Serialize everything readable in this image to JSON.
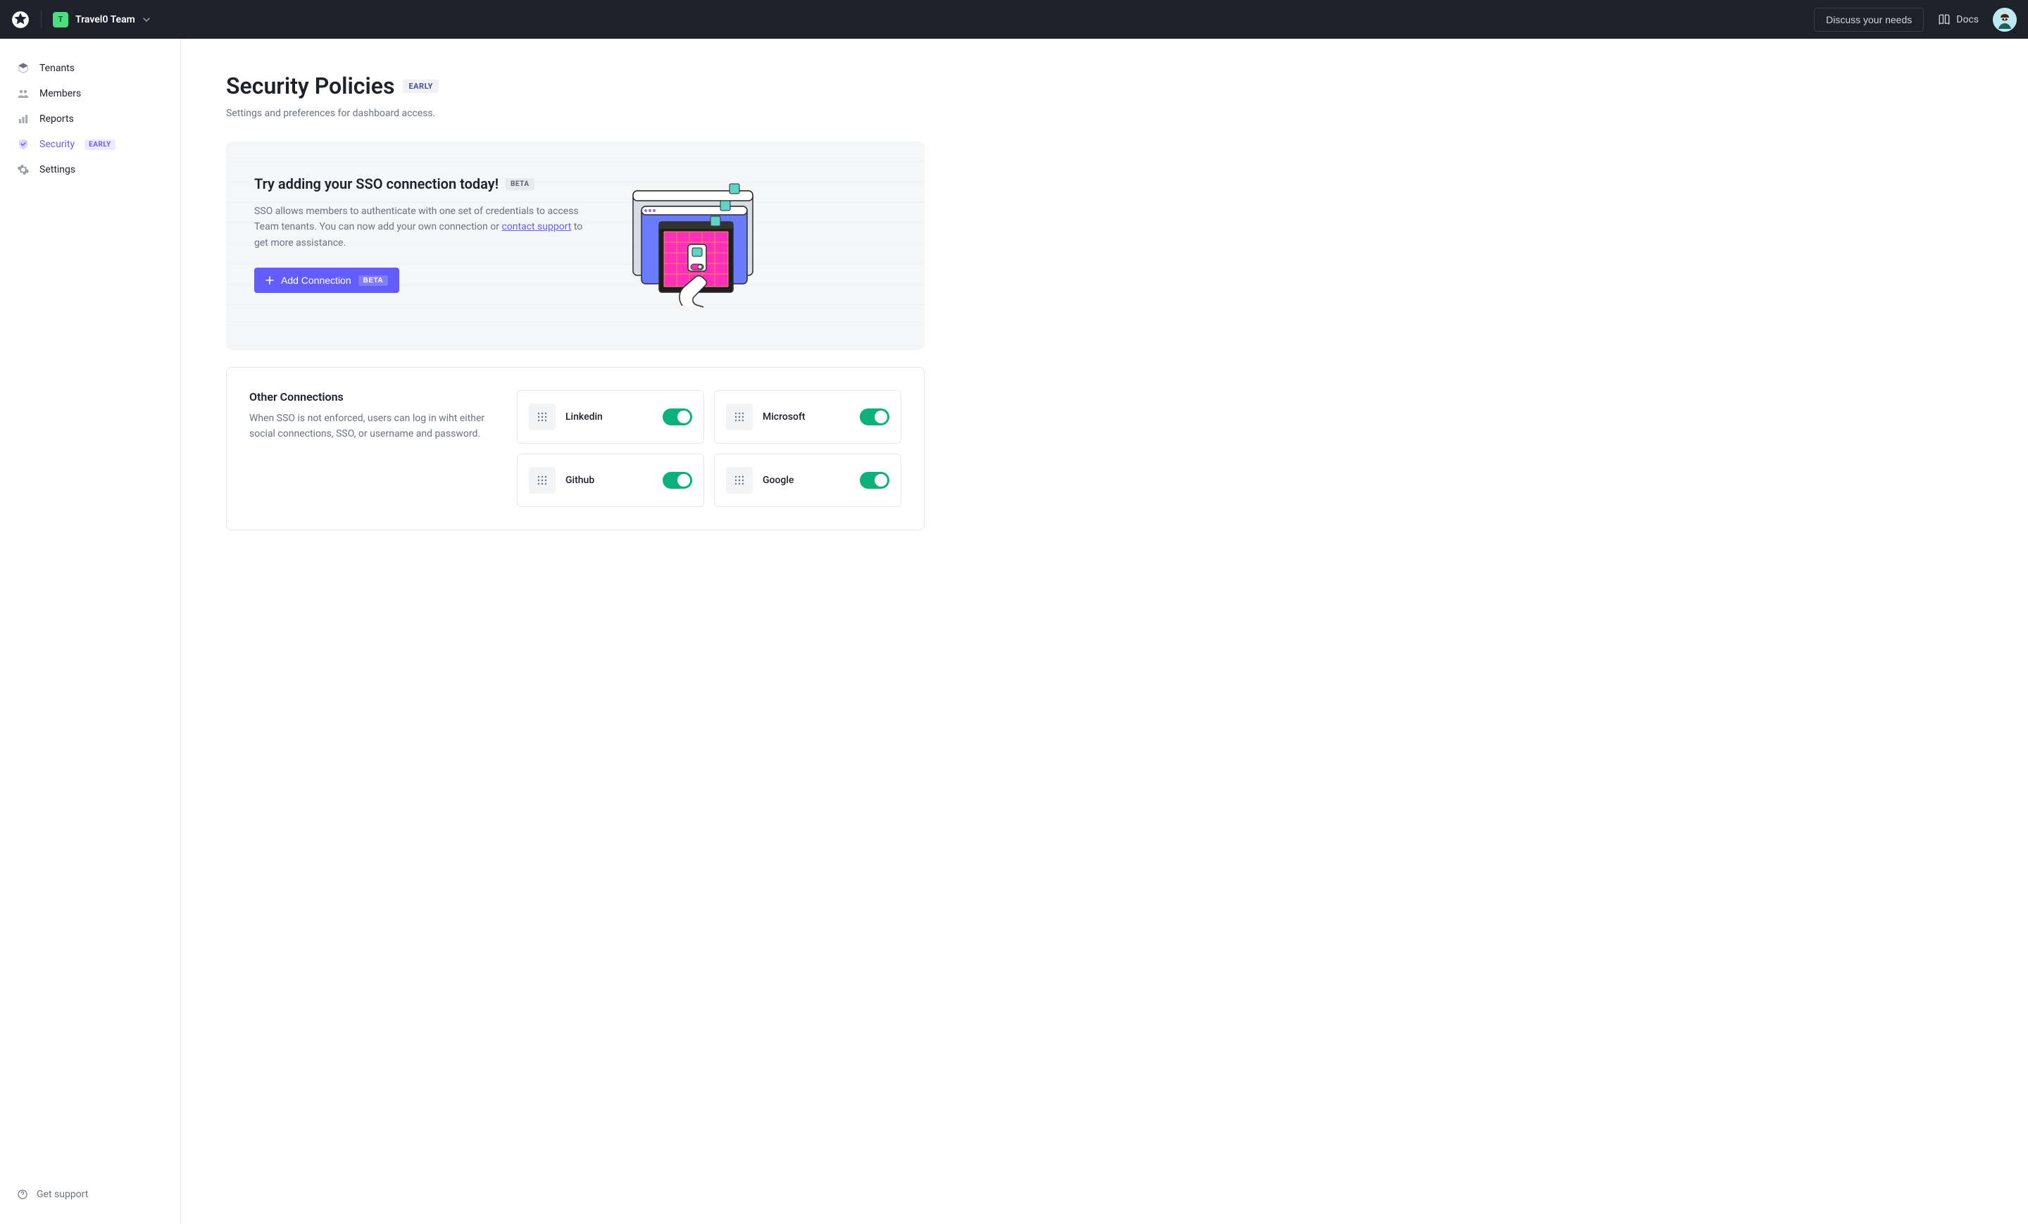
{
  "header": {
    "team_initial": "T",
    "team_name": "Travel0 Team",
    "discuss_label": "Discuss your needs",
    "docs_label": "Docs"
  },
  "sidebar": {
    "items": [
      {
        "label": "Tenants"
      },
      {
        "label": "Members"
      },
      {
        "label": "Reports"
      },
      {
        "label": "Security",
        "badge": "EARLY"
      },
      {
        "label": "Settings"
      }
    ],
    "support_label": "Get support"
  },
  "page": {
    "title": "Security Policies",
    "title_badge": "EARLY",
    "description": "Settings and preferences for dashboard access."
  },
  "promo": {
    "title": "Try adding your SSO connection today!",
    "title_badge": "BETA",
    "desc_1": "SSO allows members to authenticate with one set of credentials to access Team tenants.  You can now add your own connection or ",
    "link_text": "contact support",
    "desc_2": " to get more assistance.",
    "button_label": "Add Connection",
    "button_badge": "BETA"
  },
  "connections": {
    "title": "Other Connections",
    "description": "When SSO is not enforced, users can log in wiht either social connections, SSO, or username and password.",
    "items": [
      {
        "name": "Linkedin",
        "enabled": true
      },
      {
        "name": "Microsoft",
        "enabled": true
      },
      {
        "name": "Github",
        "enabled": true
      },
      {
        "name": "Google",
        "enabled": true
      }
    ]
  }
}
